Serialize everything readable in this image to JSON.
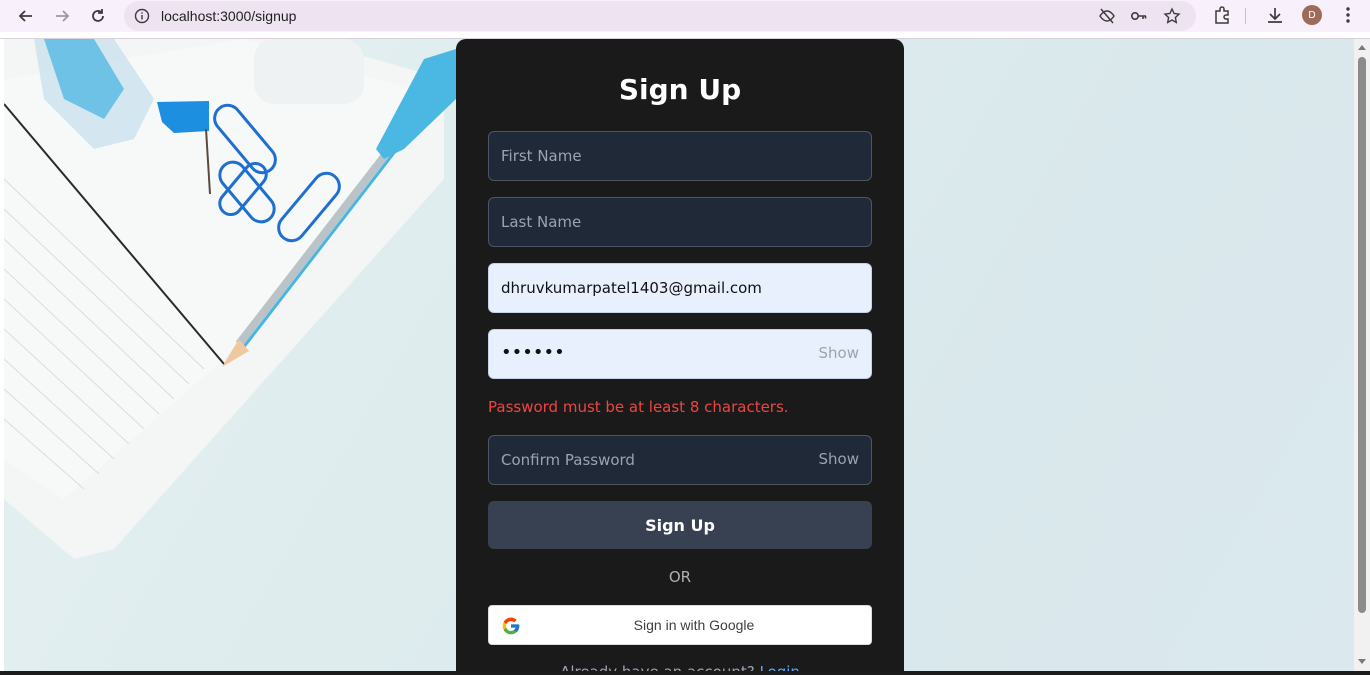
{
  "browser": {
    "url": "localhost:3000/signup",
    "profile_initial": "D"
  },
  "form": {
    "title": "Sign Up",
    "first_name_placeholder": "First Name",
    "last_name_placeholder": "Last Name",
    "email_value": "dhruvkumarpatel1403@gmail.com",
    "password_value": "••••••",
    "password_show": "Show",
    "error_message": "Password must be at least 8 characters.",
    "confirm_password_placeholder": "Confirm Password",
    "confirm_show": "Show",
    "submit_label": "Sign Up",
    "or_text": "OR",
    "google_label": "Sign in with Google",
    "footer_text": "Already have an account?",
    "login_link": "Login"
  },
  "colors": {
    "card_bg": "#1a1a1a",
    "input_bg": "#202938",
    "autofill_bg": "#e8f0fe",
    "button_bg": "#374151",
    "error": "#ef4444",
    "link": "#60a5fa"
  }
}
